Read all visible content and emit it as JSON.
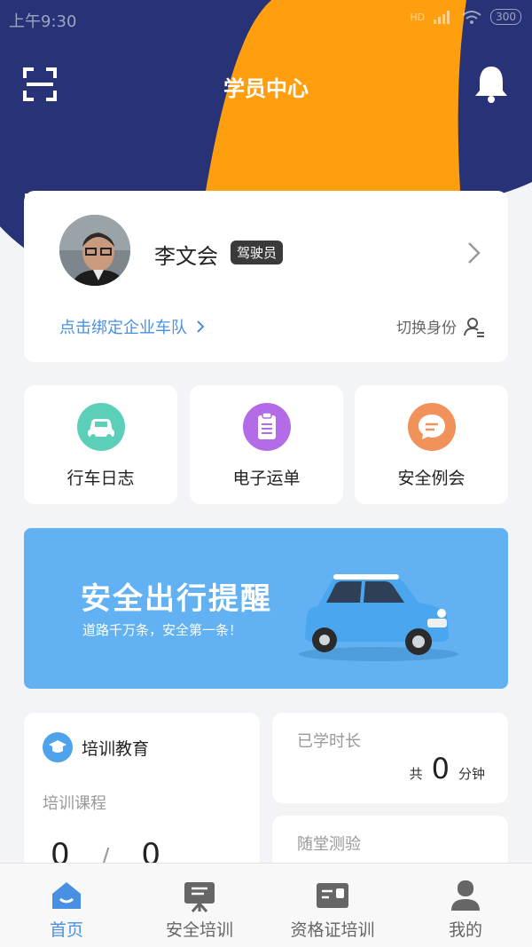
{
  "status_bar": {
    "time": "上午9:30",
    "network": "HD",
    "battery": "300"
  },
  "header": {
    "title": "学员中心",
    "icons": [
      "scan-icon",
      "bell-icon"
    ]
  },
  "profile": {
    "name": "李文会",
    "role_badge": "驾驶员",
    "bind_link": "点击绑定企业车队",
    "switch_identity": "切换身份"
  },
  "quick_actions": [
    {
      "label": "行车日志",
      "icon": "car-icon",
      "color": "#5ccfb8"
    },
    {
      "label": "电子运单",
      "icon": "clipboard-icon",
      "color": "#b46be8"
    },
    {
      "label": "安全例会",
      "icon": "chat-icon",
      "color": "#f0925a"
    }
  ],
  "banner": {
    "title": "安全出行提醒",
    "subtitle": "道路千万条，安全第一条！",
    "background": "#62b2f3"
  },
  "training": {
    "title": "培训教育",
    "course_label": "培训课程",
    "completed": "0",
    "separator": "/",
    "total": "0"
  },
  "study_time": {
    "title": "已学时长",
    "prefix": "共",
    "value": "0",
    "unit": "分钟"
  },
  "quiz": {
    "title": "随堂测验"
  },
  "tabs": [
    {
      "label": "首页",
      "icon": "home-icon",
      "active": true
    },
    {
      "label": "安全培训",
      "icon": "training-board-icon",
      "active": false
    },
    {
      "label": "资格证培训",
      "icon": "certificate-icon",
      "active": false
    },
    {
      "label": "我的",
      "icon": "user-icon",
      "active": false
    }
  ],
  "colors": {
    "header_navy": "#283276",
    "header_orange": "#ff9f0f",
    "accent_blue": "#4a90e2",
    "page_background": "#f3f4f7"
  }
}
